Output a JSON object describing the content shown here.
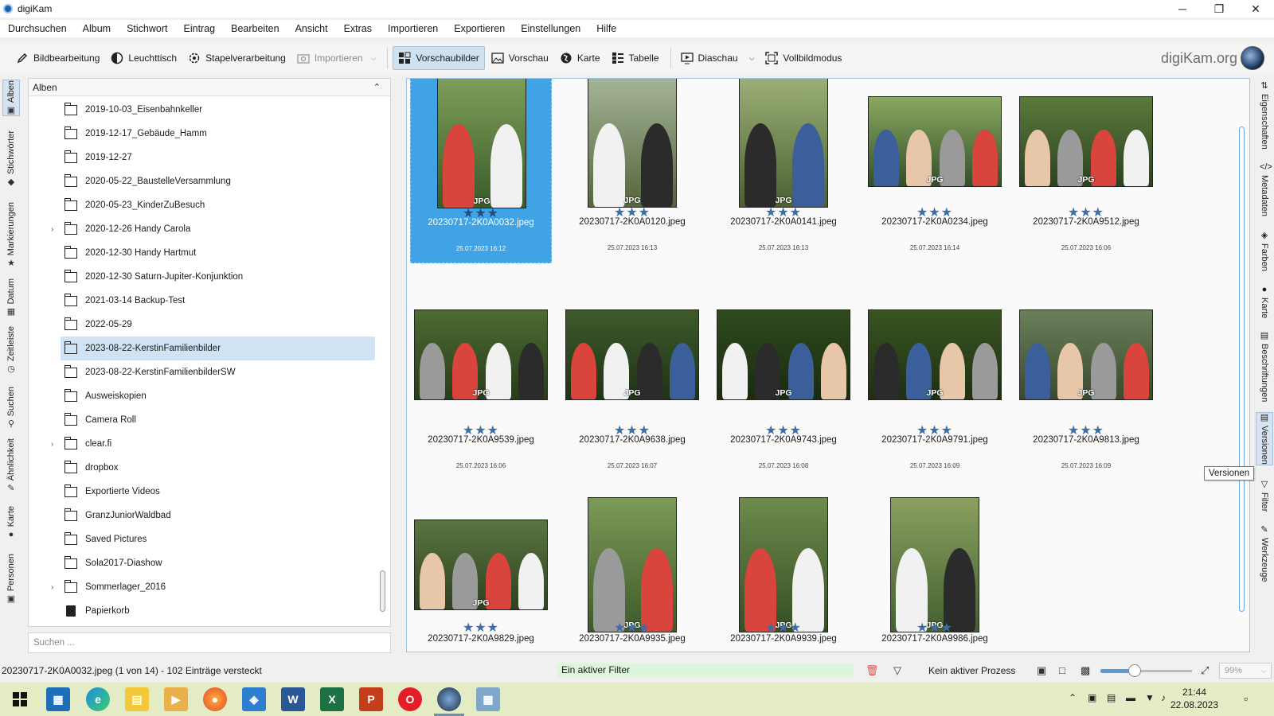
{
  "window": {
    "title": "digiKam",
    "controls": {
      "minimize": "─",
      "restore": "❐",
      "close": "✕"
    }
  },
  "menu": [
    "Durchsuchen",
    "Album",
    "Stichwort",
    "Eintrag",
    "Bearbeiten",
    "Ansicht",
    "Extras",
    "Importieren",
    "Exportieren",
    "Einstellungen",
    "Hilfe"
  ],
  "toolbar": {
    "image_editor": "Bildbearbeitung",
    "light_table": "Leuchttisch",
    "batch": "Stapelverarbeitung",
    "import": "Importieren",
    "thumbnails": "Vorschaubilder",
    "preview": "Vorschau",
    "map": "Karte",
    "table": "Tabelle",
    "slideshow": "Diaschau",
    "fullscreen": "Vollbildmodus",
    "brand": "digiKam.org"
  },
  "left_tabs": [
    "Alben",
    "Stichwörter",
    "Markierungen",
    "Datum",
    "Zeitleiste",
    "Suchen",
    "Ähnlichkeit",
    "Karte",
    "Personen"
  ],
  "album_panel": {
    "header": "Alben",
    "items": [
      {
        "label": "2019-10-03_Eisenbahnkeller",
        "expandable": false
      },
      {
        "label": "2019-12-17_Gebäude_Hamm",
        "expandable": false
      },
      {
        "label": "2019-12-27",
        "expandable": false
      },
      {
        "label": "2020-05-22_BaustelleVersammlung",
        "expandable": false
      },
      {
        "label": "2020-05-23_KinderZuBesuch",
        "expandable": false
      },
      {
        "label": "2020-12-26 Handy Carola",
        "expandable": true
      },
      {
        "label": "2020-12-30 Handy Hartmut",
        "expandable": false
      },
      {
        "label": "2020-12-30 Saturn-Jupiter-Konjunktion",
        "expandable": false
      },
      {
        "label": "2021-03-14 Backup-Test",
        "expandable": false
      },
      {
        "label": "2022-05-29",
        "expandable": false
      },
      {
        "label": "2023-08-22-KerstinFamilienbilder",
        "expandable": false,
        "selected": true
      },
      {
        "label": "2023-08-22-KerstinFamilienbilderSW",
        "expandable": false
      },
      {
        "label": "Ausweiskopien",
        "expandable": false
      },
      {
        "label": "Camera Roll",
        "expandable": false
      },
      {
        "label": "clear.fi",
        "expandable": true
      },
      {
        "label": "dropbox",
        "expandable": false
      },
      {
        "label": "Exportierte Videos",
        "expandable": false
      },
      {
        "label": "GranzJuniorWaldbad",
        "expandable": false
      },
      {
        "label": "Saved Pictures",
        "expandable": false
      },
      {
        "label": "Sola2017-Diashow",
        "expandable": false
      },
      {
        "label": "Sommerlager_2016",
        "expandable": true
      },
      {
        "label": "Papierkorb",
        "expandable": false,
        "trash": true
      }
    ],
    "search_placeholder": "Suchen ..."
  },
  "thumbnails": [
    {
      "name": "20230717-2K0A0032.jpeg",
      "date": "25.07.2023 16:12",
      "badge": "JPG",
      "stars": "★★★",
      "orientation": "portrait",
      "selected": true
    },
    {
      "name": "20230717-2K0A0120.jpeg",
      "date": "25.07.2023 16:13",
      "badge": "JPG",
      "stars": "★★★",
      "orientation": "portrait"
    },
    {
      "name": "20230717-2K0A0141.jpeg",
      "date": "25.07.2023 16:13",
      "badge": "JPG",
      "stars": "★★★",
      "orientation": "portrait"
    },
    {
      "name": "20230717-2K0A0234.jpeg",
      "date": "25.07.2023 16:14",
      "badge": "JPG",
      "stars": "★★★",
      "orientation": "landscape"
    },
    {
      "name": "20230717-2K0A9512.jpeg",
      "date": "25.07.2023 16:06",
      "badge": "JPG",
      "stars": "★★★",
      "orientation": "landscape"
    },
    {
      "name": "20230717-2K0A9539.jpeg",
      "date": "25.07.2023 16:06",
      "badge": "JPG",
      "stars": "★★★",
      "orientation": "landscape"
    },
    {
      "name": "20230717-2K0A9638.jpeg",
      "date": "25.07.2023 16:07",
      "badge": "JPG",
      "stars": "★★★",
      "orientation": "landscape"
    },
    {
      "name": "20230717-2K0A9743.jpeg",
      "date": "25.07.2023 16:08",
      "badge": "JPG",
      "stars": "★★★",
      "orientation": "landscape"
    },
    {
      "name": "20230717-2K0A9791.jpeg",
      "date": "25.07.2023 16:09",
      "badge": "JPG",
      "stars": "★★★",
      "orientation": "landscape"
    },
    {
      "name": "20230717-2K0A9813.jpeg",
      "date": "25.07.2023 16:09",
      "badge": "JPG",
      "stars": "★★★",
      "orientation": "landscape"
    },
    {
      "name": "20230717-2K0A9829.jpeg",
      "date": "",
      "badge": "JPG",
      "stars": "★★★",
      "orientation": "landscape"
    },
    {
      "name": "20230717-2K0A9935.jpeg",
      "date": "",
      "badge": "JPG",
      "stars": "★★★",
      "orientation": "portrait"
    },
    {
      "name": "20230717-2K0A9939.jpeg",
      "date": "",
      "badge": "JPG",
      "stars": "★★★",
      "orientation": "portrait"
    },
    {
      "name": "20230717-2K0A9986.jpeg",
      "date": "",
      "badge": "JPG",
      "stars": "★★★",
      "orientation": "portrait"
    }
  ],
  "right_tabs": [
    "Eigenschaften",
    "Metadaten",
    "Farben",
    "Karte",
    "Beschriftungen",
    "Versionen",
    "Filter",
    "Werkzeuge"
  ],
  "tooltip": "Versionen",
  "status": {
    "left": "20230717-2K0A0032.jpeg (1 von 14) - 102 Einträge versteckt",
    "filter": "Ein aktiver Filter",
    "process": "Kein aktiver Prozess",
    "zoom": "99%",
    "zoom_level": 0.37
  },
  "taskbar": {
    "time": "21:44",
    "date": "22.08.2023"
  },
  "colors": {
    "selection": "#3fa3e6",
    "album_selected": "#cfe3f5",
    "stars": "#3b6fa8",
    "filter_bg": "#dcf5dc"
  }
}
